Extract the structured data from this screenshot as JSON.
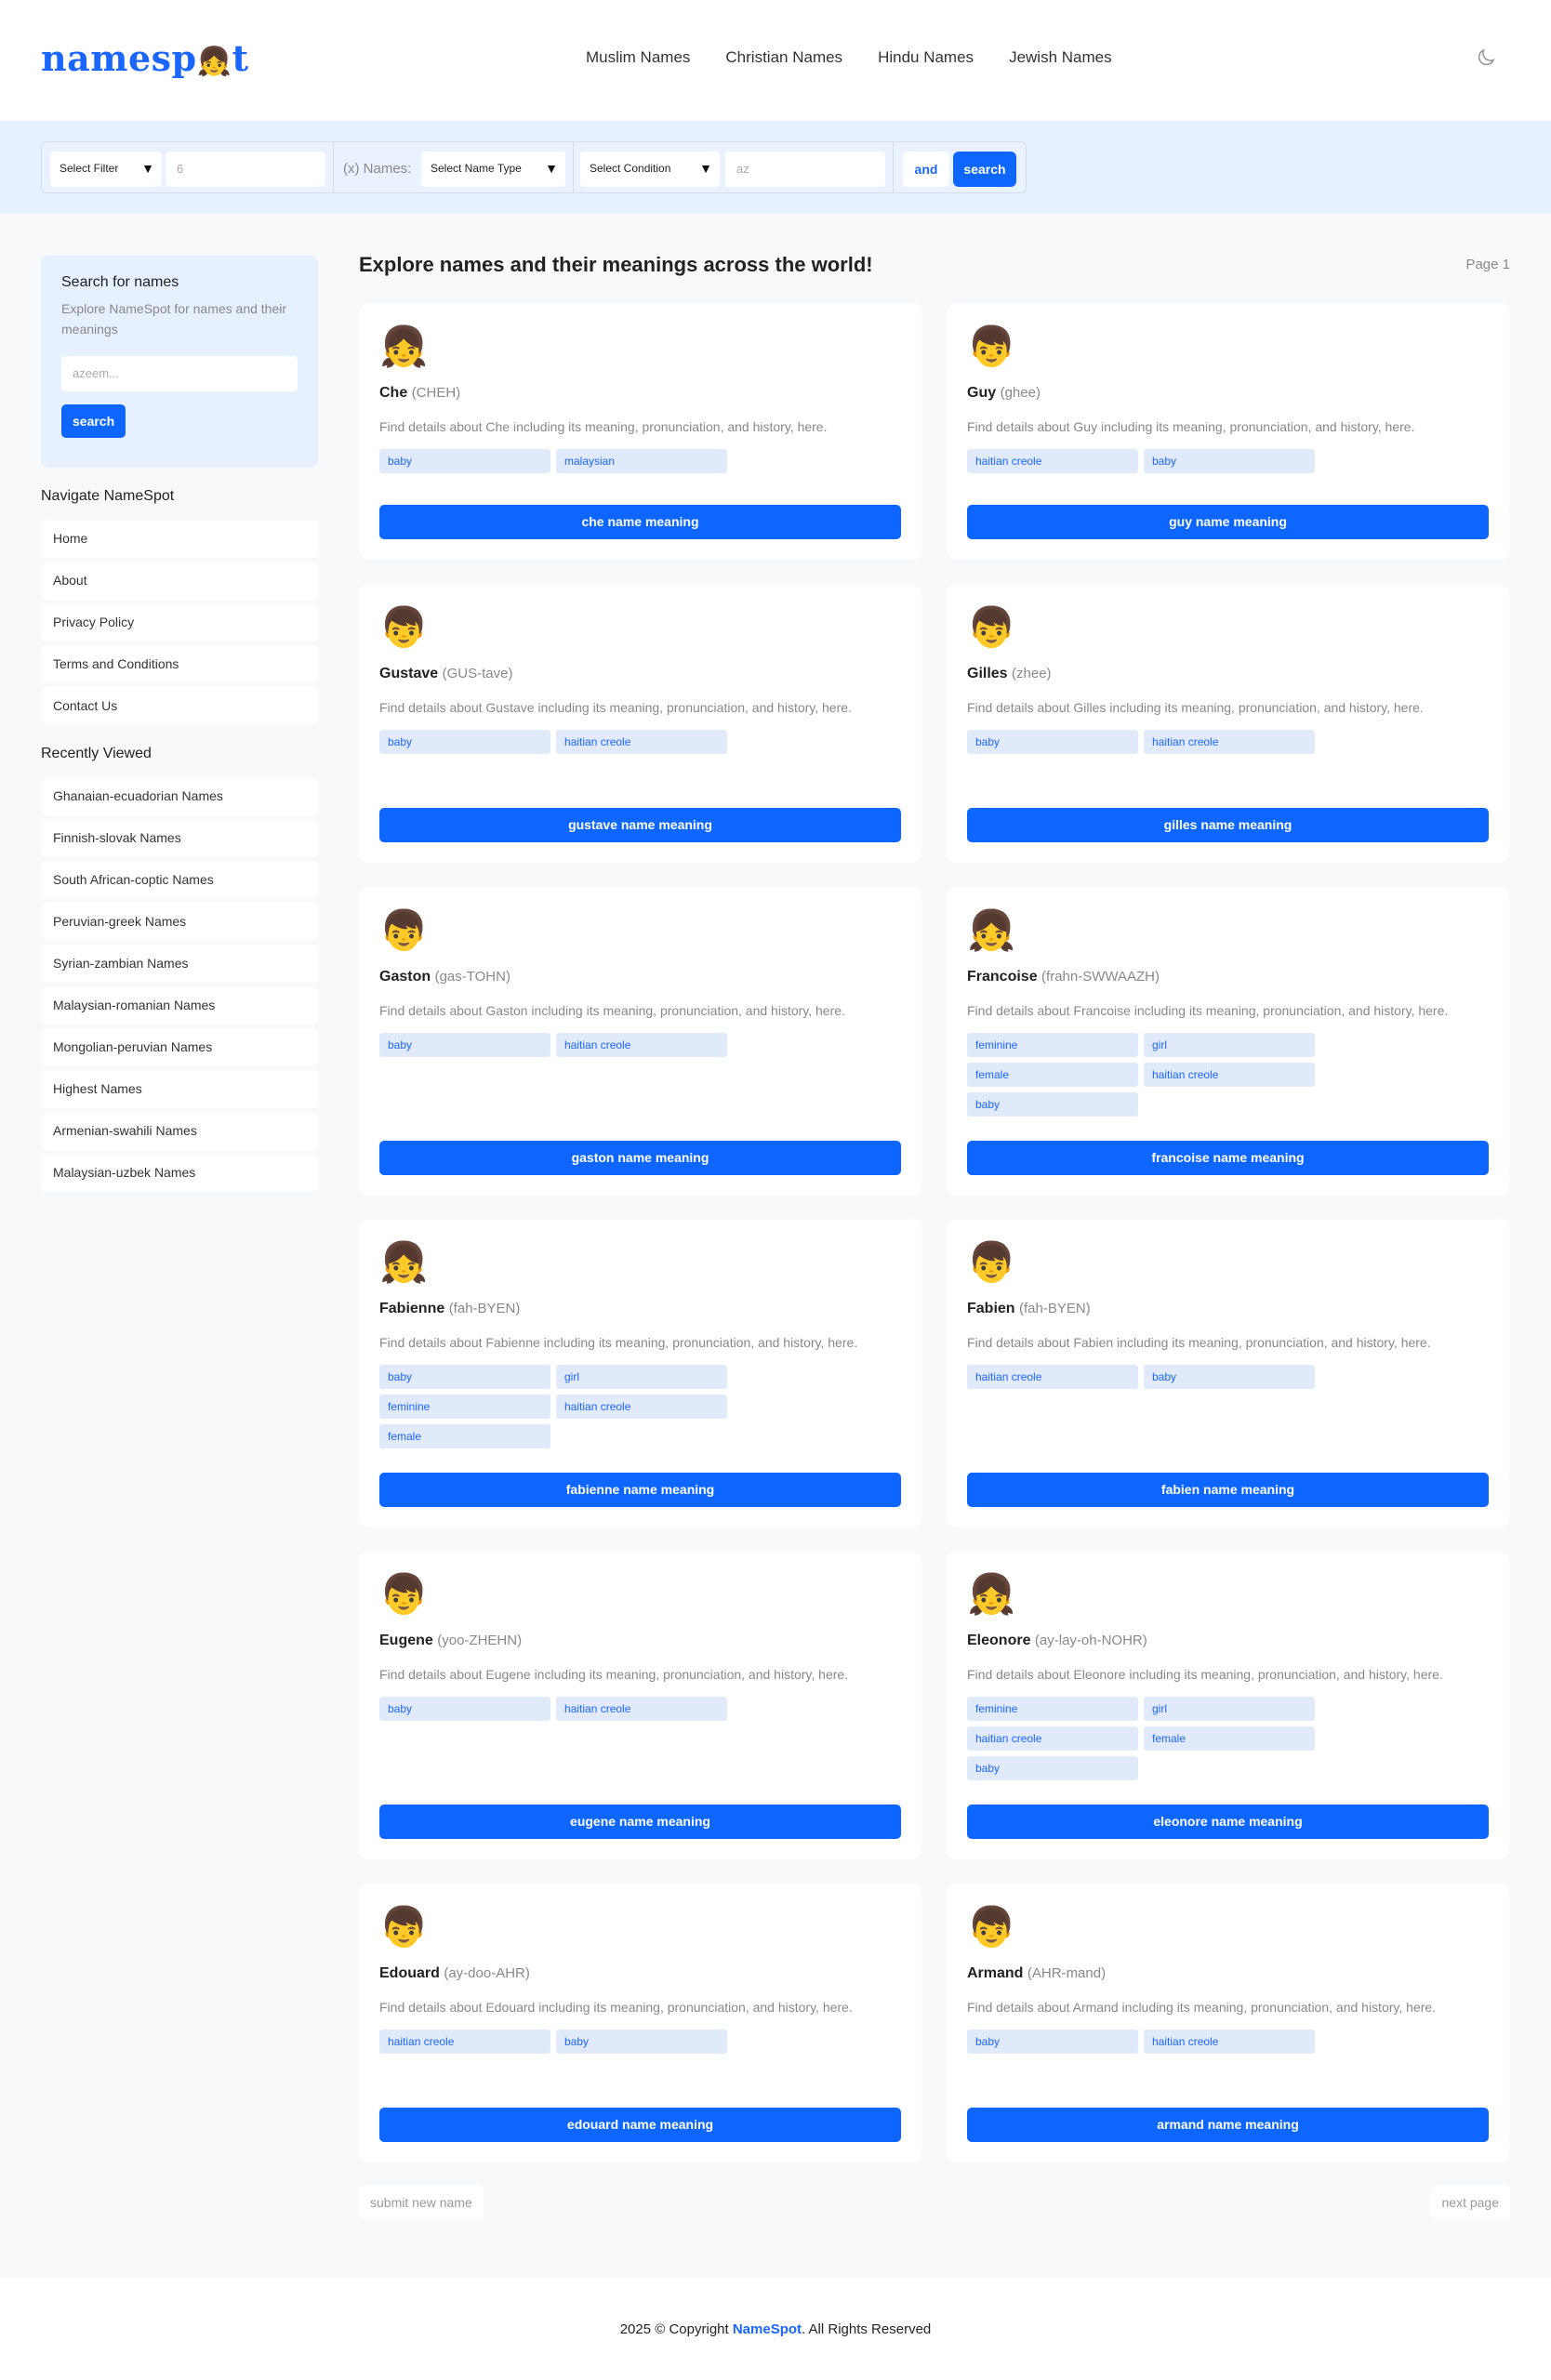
{
  "header": {
    "logo_text": "namesp",
    "logo_tail": "t",
    "logo_emoji": "👧",
    "nav": [
      "Muslim Names",
      "Christian Names",
      "Hindu Names",
      "Jewish Names"
    ],
    "theme_icon": "moon-icon"
  },
  "filter": {
    "select_filter": "Select Filter",
    "number_placeholder": "6",
    "x_names_label": "(x) Names:",
    "select_name_type": "Select Name Type",
    "select_condition": "Select Condition",
    "text_placeholder": "az",
    "and_label": "and",
    "search_label": "search"
  },
  "sidebar": {
    "search_title": "Search for names",
    "search_desc": "Explore NameSpot for names and their meanings",
    "search_placeholder": "azeem...",
    "search_button": "search",
    "nav_heading": "Navigate NameSpot",
    "nav_items": [
      "Home",
      "About",
      "Privacy Policy",
      "Terms and Conditions",
      "Contact Us"
    ],
    "recent_heading": "Recently Viewed",
    "recent_items": [
      "Ghanaian-ecuadorian Names",
      "Finnish-slovak Names",
      "South African-coptic Names",
      "Peruvian-greek Names",
      "Syrian-zambian Names",
      "Malaysian-romanian Names",
      "Mongolian-peruvian Names",
      "Highest Names",
      "Armenian-swahili Names",
      "Malaysian-uzbek Names"
    ]
  },
  "main": {
    "title": "Explore names and their meanings across the world!",
    "page_label": "Page 1",
    "cards": [
      {
        "emoji": "👧",
        "name": "Che",
        "pron": "(CHEH)",
        "desc": "Find details about Che including its meaning, pronunciation, and history, here.",
        "tags": [
          "baby",
          "malaysian"
        ],
        "button": "che name meaning"
      },
      {
        "emoji": "👦",
        "name": "Guy",
        "pron": "(ghee)",
        "desc": "Find details about Guy including its meaning, pronunciation, and history, here.",
        "tags": [
          "haitian creole",
          "baby"
        ],
        "button": "guy name meaning"
      },
      {
        "emoji": "👦",
        "name": "Gustave",
        "pron": "(GUS-tave)",
        "desc": "Find details about Gustave including its meaning, pronunciation, and history, here.",
        "tags": [
          "baby",
          "haitian creole"
        ],
        "button": "gustave name meaning"
      },
      {
        "emoji": "👦",
        "name": "Gilles",
        "pron": "(zhee)",
        "desc": "Find details about Gilles including its meaning, pronunciation, and history, here.",
        "tags": [
          "baby",
          "haitian creole"
        ],
        "button": "gilles name meaning"
      },
      {
        "emoji": "👦",
        "name": "Gaston",
        "pron": "(gas-TOHN)",
        "desc": "Find details about Gaston including its meaning, pronunciation, and history, here.",
        "tags": [
          "baby",
          "haitian creole"
        ],
        "button": "gaston name meaning"
      },
      {
        "emoji": "👧",
        "name": "Francoise",
        "pron": "(frahn-SWWAAZH)",
        "desc": "Find details about Francoise including its meaning, pronunciation, and history, here.",
        "tags": [
          "feminine",
          "girl",
          "female",
          "haitian creole",
          "baby"
        ],
        "button": "francoise name meaning"
      },
      {
        "emoji": "👧",
        "name": "Fabienne",
        "pron": "(fah-BYEN)",
        "desc": "Find details about Fabienne including its meaning, pronunciation, and history, here.",
        "tags": [
          "baby",
          "girl",
          "feminine",
          "haitian creole",
          "female"
        ],
        "button": "fabienne name meaning"
      },
      {
        "emoji": "👦",
        "name": "Fabien",
        "pron": "(fah-BYEN)",
        "desc": "Find details about Fabien including its meaning, pronunciation, and history, here.",
        "tags": [
          "haitian creole",
          "baby"
        ],
        "button": "fabien name meaning"
      },
      {
        "emoji": "👦",
        "name": "Eugene",
        "pron": "(yoo-ZHEHN)",
        "desc": "Find details about Eugene including its meaning, pronunciation, and history, here.",
        "tags": [
          "baby",
          "haitian creole"
        ],
        "button": "eugene name meaning"
      },
      {
        "emoji": "👧",
        "name": "Eleonore",
        "pron": "(ay-lay-oh-NOHR)",
        "desc": "Find details about Eleonore including its meaning, pronunciation, and history, here.",
        "tags": [
          "feminine",
          "girl",
          "haitian creole",
          "female",
          "baby"
        ],
        "button": "eleonore name meaning"
      },
      {
        "emoji": "👦",
        "name": "Edouard",
        "pron": "(ay-doo-AHR)",
        "desc": "Find details about Edouard including its meaning, pronunciation, and history, here.",
        "tags": [
          "haitian creole",
          "baby"
        ],
        "button": "edouard name meaning"
      },
      {
        "emoji": "👦",
        "name": "Armand",
        "pron": "(AHR-mand)",
        "desc": "Find details about Armand including its meaning, pronunciation, and history, here.",
        "tags": [
          "baby",
          "haitian creole"
        ],
        "button": "armand name meaning"
      }
    ],
    "submit_label": "submit new name",
    "next_label": "next page"
  },
  "footer": {
    "prefix": "2025 © Copyright ",
    "brand": "NameSpot",
    "suffix": ". All Rights Reserved"
  },
  "colors": {
    "accent": "#0d66ff",
    "light_bg": "#e6f0ff"
  }
}
